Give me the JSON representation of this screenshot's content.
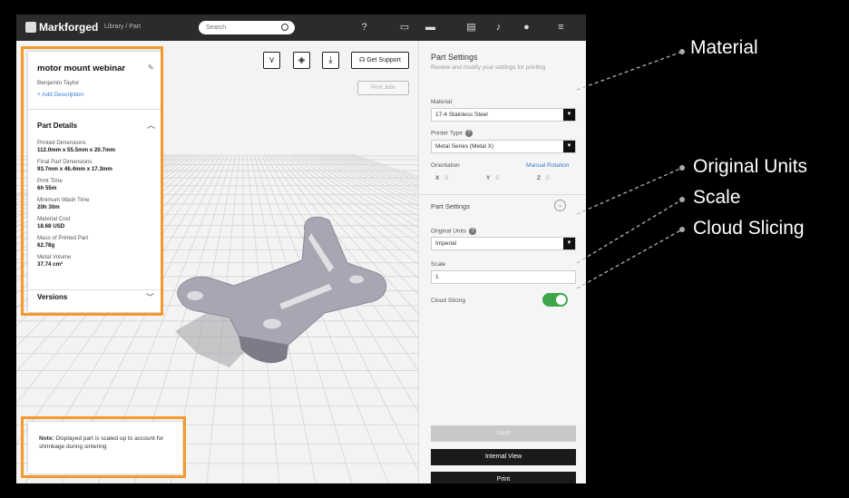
{
  "app": {
    "logo_text": "Markforged",
    "breadcrumb": "Library  /  Part",
    "search_placeholder": "Search"
  },
  "toolbar": {
    "support_label": "Get Support",
    "print_jobs_label": "Print Jobs"
  },
  "part": {
    "title": "motor mount webinar",
    "owner": "Benjamin Taylor",
    "add_description": "+ Add Description",
    "details_heading": "Part Details",
    "details": [
      {
        "label": "Printed Dimensions",
        "value": "112.0mm x 55.5mm x 20.7mm"
      },
      {
        "label": "Final Part Dimensions",
        "value": "93.7mm x 46.4mm x 17.3mm"
      },
      {
        "label": "Print Time",
        "value": "6h 55m"
      },
      {
        "label": "Minimum Wash Time",
        "value": "20h 30m"
      },
      {
        "label": "Material Cost",
        "value": "18.68 USD"
      },
      {
        "label": "Mass of Printed Part",
        "value": "62.78g"
      },
      {
        "label": "Metal Volume",
        "value": "37.74 cm³"
      }
    ],
    "versions_heading": "Versions"
  },
  "note": {
    "bold": "Note:",
    "text": " Displayed part is scaled up to account for shrinkage during sintering"
  },
  "settings": {
    "title": "Part Settings",
    "subtitle": "Review and modify your settings for printing",
    "material_label": "Material",
    "material_value": "17-4 Stainless Steel",
    "printer_label": "Printer Type",
    "printer_value": "Metal Series (Metal X)",
    "orientation_label": "Orientation",
    "manual_rotation": "Manual Rotation",
    "x_label": "X",
    "x_value": "0",
    "y_label": "Y",
    "y_value": "0",
    "z_label": "Z",
    "z_value": "0",
    "section_heading": "Part Settings",
    "units_label": "Original Units",
    "units_value": "Imperial",
    "scale_label": "Scale",
    "scale_value": "1",
    "cloud_label": "Cloud Slicing",
    "cloud_enabled": true,
    "save_label": "Save",
    "internal_view_label": "Internal View",
    "print_label": "Print"
  },
  "callouts": {
    "material": "Material",
    "original_units": "Original Units",
    "scale": "Scale",
    "cloud_slicing": "Cloud Slicing"
  },
  "colors": {
    "highlight": "#f39a2c",
    "toggle_on": "#3ea64a",
    "topbar": "#2b2b2b",
    "part": "#a7a7b3"
  }
}
